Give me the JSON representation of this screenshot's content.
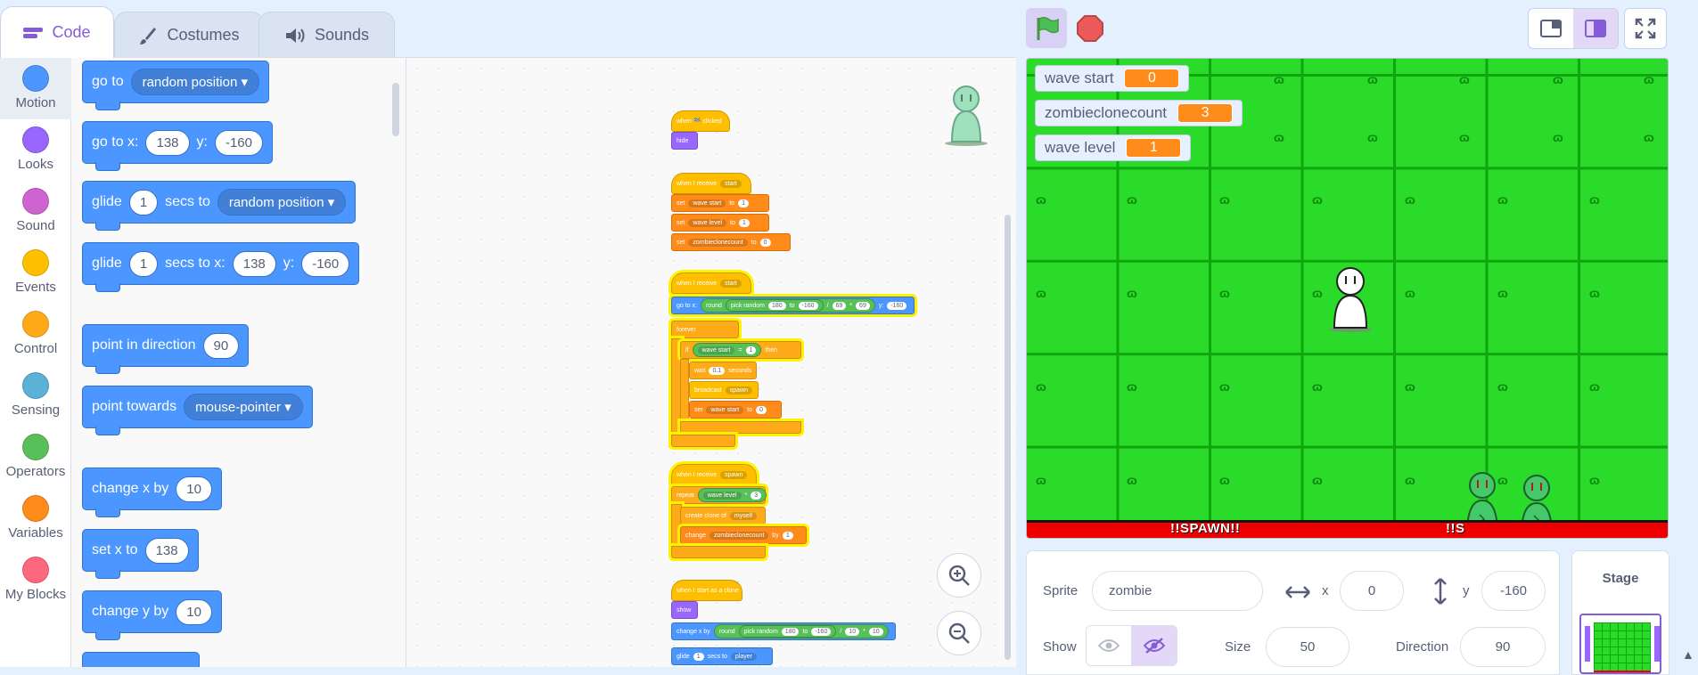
{
  "tabs": {
    "code": "Code",
    "costumes": "Costumes",
    "sounds": "Sounds"
  },
  "categories": [
    {
      "label": "Motion",
      "color": "#4c97ff"
    },
    {
      "label": "Looks",
      "color": "#9966ff"
    },
    {
      "label": "Sound",
      "color": "#cf63cf"
    },
    {
      "label": "Events",
      "color": "#ffbf00"
    },
    {
      "label": "Control",
      "color": "#ffab19"
    },
    {
      "label": "Sensing",
      "color": "#5cb1d6"
    },
    {
      "label": "Operators",
      "color": "#59c059"
    },
    {
      "label": "Variables",
      "color": "#ff8c1a"
    },
    {
      "label": "My Blocks",
      "color": "#ff6680"
    }
  ],
  "palette": {
    "go_to": {
      "text": "go to",
      "target": "random position"
    },
    "go_to_xy": {
      "text": "go to x:",
      "x": "138",
      "ylabel": "y:",
      "y": "-160"
    },
    "glide_to": {
      "text": "glide",
      "secs": "1",
      "secs_to": "secs to",
      "target": "random position"
    },
    "glide_xy": {
      "text": "glide",
      "secs": "1",
      "secs_to": "secs to x:",
      "x": "138",
      "ylabel": "y:",
      "y": "-160"
    },
    "point_dir": {
      "text": "point in direction",
      "value": "90"
    },
    "point_towards": {
      "text": "point towards",
      "target": "mouse-pointer"
    },
    "change_x": {
      "text": "change x by",
      "value": "10"
    },
    "set_x": {
      "text": "set x to",
      "value": "138"
    },
    "change_y": {
      "text": "change y by",
      "value": "10"
    }
  },
  "scripts": {
    "s1": {
      "hat": "when 🏁 clicked",
      "b1": "hide"
    },
    "s2": {
      "hat": "when I receive",
      "hat_msg": "start",
      "set": "set",
      "to": "to",
      "var1": "wave start",
      "val1": "1",
      "var2": "wave level",
      "val2": "1",
      "var3": "zombieclonecount",
      "val3": "0"
    },
    "s3": {
      "hat": "when I receive",
      "hat_msg": "start",
      "goto": "go to x:",
      "round": "round",
      "pick": "pick random",
      "to": "to",
      "n1": "180",
      "n2": "-160",
      "div": "/",
      "n3": "69",
      "mul": "*",
      "n4": "69",
      "ylabel": "y:",
      "y": "-160",
      "forever": "forever",
      "if": "if",
      "cond_var": "wave start",
      "eq": "=",
      "cond_val": "1",
      "then": "then",
      "wait": "wait",
      "wait_val": "0.1",
      "seconds": "seconds",
      "broadcast": "broadcast",
      "bmsg": "spawn",
      "set": "set",
      "set_var": "wave start",
      "set_to": "to",
      "set_val": "0"
    },
    "s4": {
      "hat": "when I receive",
      "hat_msg": "spawn",
      "repeat": "repeat",
      "rep_var": "wave level",
      "mul": "*",
      "rep_val": "3",
      "create": "create clone of",
      "create_t": "myself",
      "change": "change",
      "change_var": "zombieclonecount",
      "by": "by",
      "change_val": "1"
    },
    "s5": {
      "hat": "when I start as a clone",
      "show": "show",
      "changex": "change x by",
      "round": "round",
      "pick": "pick random",
      "n1": "180",
      "to": "to",
      "n2": "-160",
      "div": "/",
      "n3": "10",
      "mul": "*",
      "n4": "10",
      "glide": "glide",
      "glide_val": "1",
      "secs_to": "secs to",
      "glide_t": "player"
    }
  },
  "stage": {
    "monitors": [
      {
        "label": "wave start",
        "value": "0"
      },
      {
        "label": "zombieclonecount",
        "value": "3"
      },
      {
        "label": "wave level",
        "value": "1"
      }
    ],
    "spawn_left": "!!SPAWN!!",
    "spawn_right": "!!S"
  },
  "sprite_info": {
    "sprite_label": "Sprite",
    "sprite_name": "zombie",
    "x_label": "x",
    "x": "0",
    "y_label": "y",
    "y": "-160",
    "show_label": "Show",
    "size_label": "Size",
    "size": "50",
    "direction_label": "Direction",
    "direction": "90"
  },
  "stage_pane": {
    "label": "Stage"
  }
}
